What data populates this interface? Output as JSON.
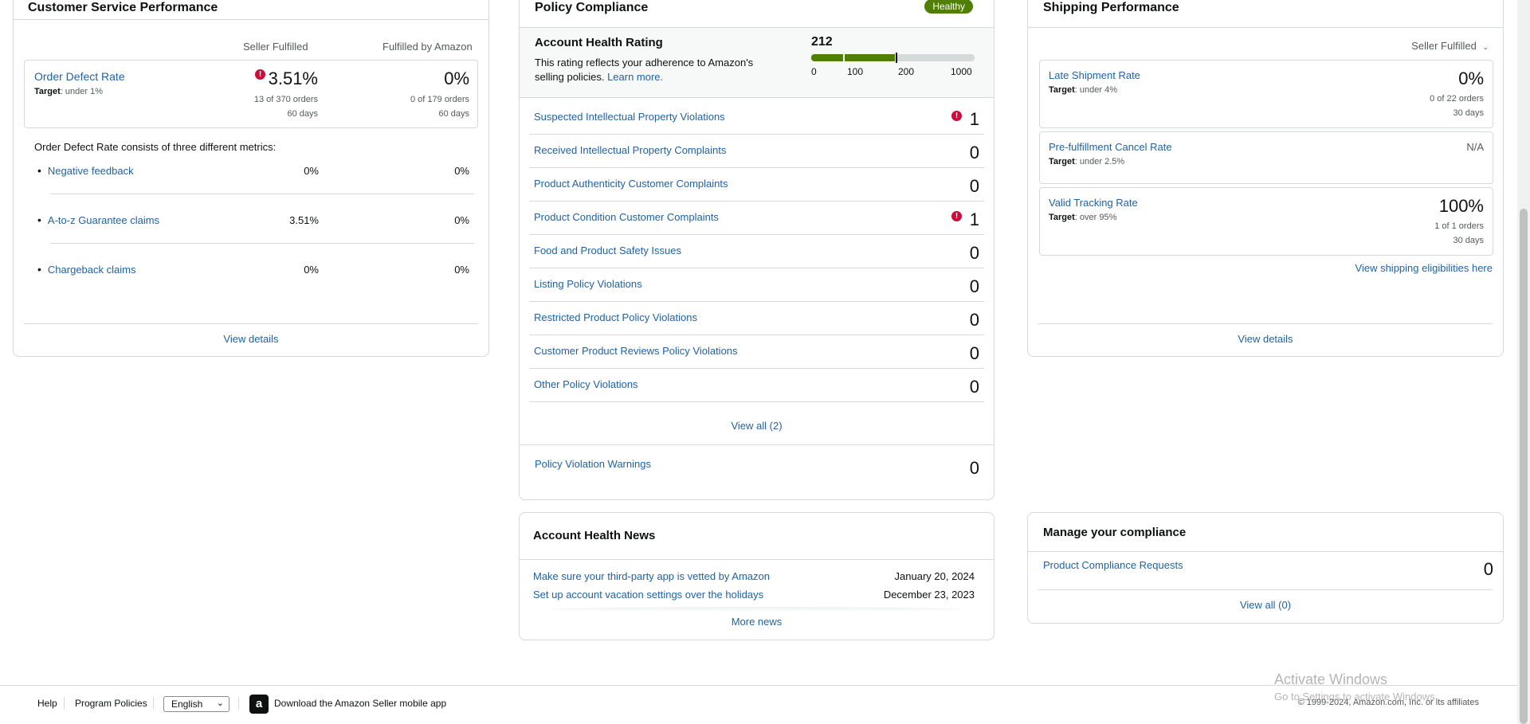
{
  "csp": {
    "title": "Customer Service Performance",
    "col1": "Seller Fulfilled",
    "col2": "Fulfilled by Amazon",
    "odr": {
      "label": "Order Defect Rate",
      "target_label": "Target",
      "target_value": ": under 1%",
      "sf_value": "3.51%",
      "sf_orders": "13 of 370 orders",
      "sf_days": "60 days",
      "fba_value": "0%",
      "fba_orders": "0 of 179 orders",
      "fba_days": "60 days"
    },
    "consists": "Order Defect Rate consists of three different metrics:",
    "metrics": [
      {
        "label": "Negative feedback",
        "sf": "0%",
        "fba": "0%"
      },
      {
        "label": "A-to-z Guarantee claims",
        "sf": "3.51%",
        "fba": "0%"
      },
      {
        "label": "Chargeback claims",
        "sf": "0%",
        "fba": "0%"
      }
    ],
    "view_details": "View details"
  },
  "pc": {
    "title": "Policy Compliance",
    "badge": "Healthy",
    "ahr_title": "Account Health Rating",
    "ahr_desc": "This rating reflects your adherence to Amazon's selling policies.",
    "learn_more": "Learn more.",
    "score": "212",
    "scale": [
      "0",
      "100",
      "200",
      "1000"
    ],
    "rows": [
      {
        "label": "Suspected Intellectual Property Violations",
        "count": "1"
      },
      {
        "label": "Received Intellectual Property Complaints",
        "count": "0"
      },
      {
        "label": "Product Authenticity Customer Complaints",
        "count": "0"
      },
      {
        "label": "Product Condition Customer Complaints",
        "count": "1"
      },
      {
        "label": "Food and Product Safety Issues",
        "count": "0"
      },
      {
        "label": "Listing Policy Violations",
        "count": "0"
      },
      {
        "label": "Restricted Product Policy Violations",
        "count": "0"
      },
      {
        "label": "Customer Product Reviews Policy Violations",
        "count": "0"
      },
      {
        "label": "Other Policy Violations",
        "count": "0"
      }
    ],
    "view_all": "View all (2)",
    "warnings_label": "Policy Violation Warnings",
    "warnings_count": "0"
  },
  "news": {
    "title": "Account Health News",
    "items": [
      {
        "label": "Make sure your third-party app is vetted by Amazon",
        "date": "January 20, 2024"
      },
      {
        "label": "Set up account vacation settings over the holidays",
        "date": "December 23, 2023"
      }
    ],
    "more": "More news"
  },
  "sp": {
    "title": "Shipping Performance",
    "filter": "Seller Fulfilled",
    "late": {
      "label": "Late Shipment Rate",
      "target_label": "Target",
      "target_value": ": under 4%",
      "value": "0%",
      "orders": "0 of 22 orders",
      "days": "30 days"
    },
    "cancel": {
      "label": "Pre-fulfillment Cancel Rate",
      "target_label": "Target",
      "target_value": ": under 2.5%",
      "value": "N/A"
    },
    "tracking": {
      "label": "Valid Tracking Rate",
      "target_label": "Target",
      "target_value": ": over 95%",
      "value": "100%",
      "orders": "1 of 1 orders",
      "days": "30 days"
    },
    "eligibilities": "View shipping eligibilities here",
    "view_details": "View details"
  },
  "mc": {
    "title": "Manage your compliance",
    "label": "Product Compliance Requests",
    "count": "0",
    "view_all": "View all (0)"
  },
  "footer": {
    "help": "Help",
    "policies": "Program Policies",
    "language": "English",
    "app": "Download the Amazon Seller mobile app",
    "copyright": "© 1999-2024, Amazon.com, Inc. or its affiliates",
    "activate": "Activate Windows",
    "activate_sub": "Go to Settings to activate Windows."
  },
  "colors": {
    "accent": "#2162a1",
    "healthy": "#507f04",
    "alert": "#cc0c39"
  }
}
